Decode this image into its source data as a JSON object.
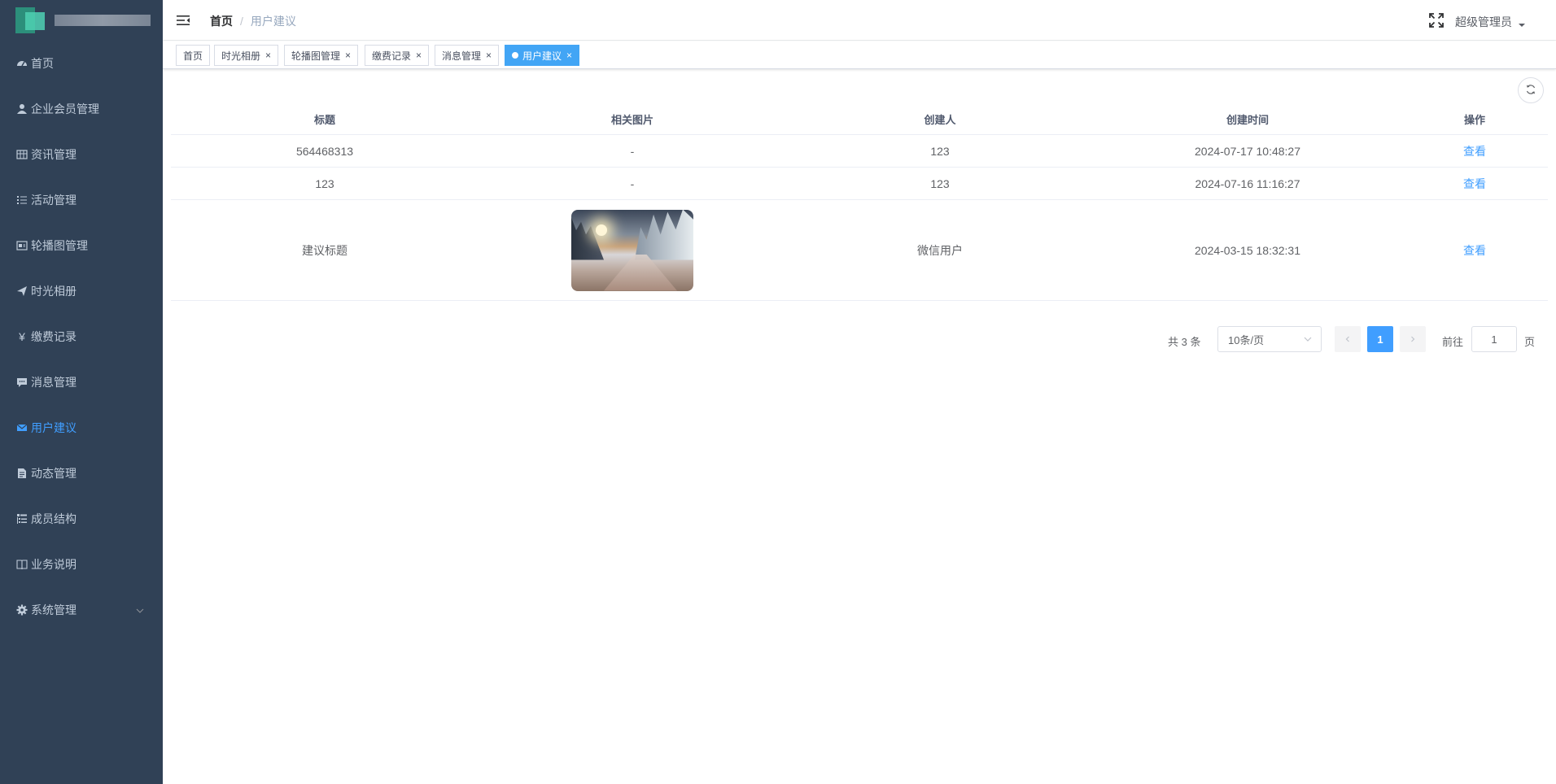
{
  "sidebar": {
    "items": [
      {
        "label": "首页",
        "icon": "dashboard-icon"
      },
      {
        "label": "企业会员管理",
        "icon": "user-icon"
      },
      {
        "label": "资讯管理",
        "icon": "table-icon"
      },
      {
        "label": "活动管理",
        "icon": "list-icon"
      },
      {
        "label": "轮播图管理",
        "icon": "image-icon"
      },
      {
        "label": "时光相册",
        "icon": "send-icon"
      },
      {
        "label": "缴费记录",
        "icon": "yen-icon"
      },
      {
        "label": "消息管理",
        "icon": "message-icon"
      },
      {
        "label": "用户建议",
        "icon": "mail-icon"
      },
      {
        "label": "动态管理",
        "icon": "document-icon"
      },
      {
        "label": "成员结构",
        "icon": "tree-table-icon"
      },
      {
        "label": "业务说明",
        "icon": "book-icon"
      },
      {
        "label": "系统管理",
        "icon": "gear-icon"
      }
    ],
    "active_color": "#409eff",
    "bg_color": "#304156"
  },
  "header": {
    "breadcrumb": {
      "home": "首页",
      "separator": "/",
      "current": "用户建议"
    },
    "user_name": "超级管理员"
  },
  "tags": [
    {
      "label": "首页",
      "closable": false,
      "active": false
    },
    {
      "label": "时光相册",
      "closable": true,
      "active": false
    },
    {
      "label": "轮播图管理",
      "closable": true,
      "active": false
    },
    {
      "label": "缴费记录",
      "closable": true,
      "active": false
    },
    {
      "label": "消息管理",
      "closable": true,
      "active": false
    },
    {
      "label": "用户建议",
      "closable": true,
      "active": true
    }
  ],
  "tag_close_glyph": "×",
  "table": {
    "columns": [
      "标题",
      "相关图片",
      "创建人",
      "创建时间",
      "操作"
    ],
    "rows": [
      {
        "title": "564468313",
        "image": "-",
        "creator": "123",
        "created_at": "2024-07-17 10:48:27",
        "action": "查看"
      },
      {
        "title": "123",
        "image": "-",
        "creator": "123",
        "created_at": "2024-07-16 11:16:27",
        "action": "查看"
      },
      {
        "title": "建议标题",
        "image": "snow-forest-thumbnail",
        "creator": "微信用户",
        "created_at": "2024-03-15 18:32:31",
        "action": "查看"
      }
    ]
  },
  "pagination": {
    "total_text": "共 3 条",
    "page_size": "10条/页",
    "current_page": "1",
    "goto_prefix": "前往",
    "goto_value": "1",
    "goto_suffix": "页"
  }
}
